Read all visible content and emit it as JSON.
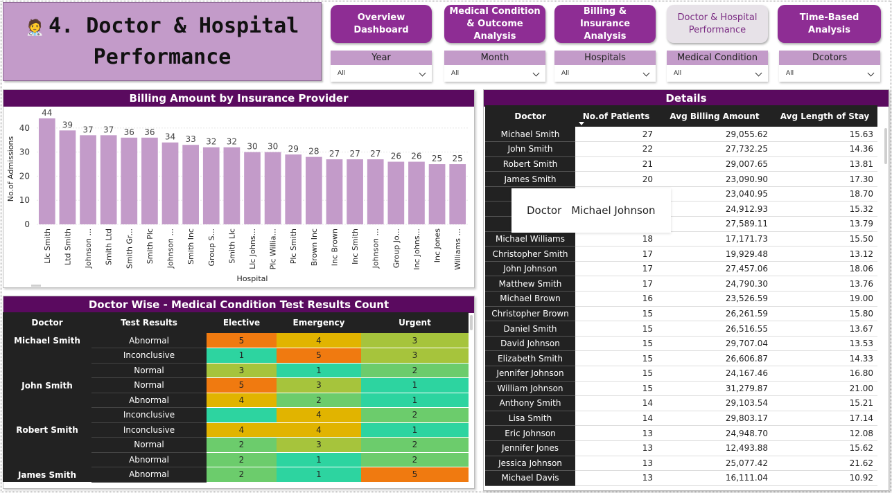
{
  "header": {
    "icon": "doctor-icon",
    "title_line1": "4. Doctor & Hospital",
    "title_line2": "Performance"
  },
  "nav": [
    {
      "label": "Overview Dashboard",
      "active": false
    },
    {
      "label": "Medical Condition & Outcome Analysis",
      "active": false
    },
    {
      "label": "Billing & Insurance Analysis",
      "active": false
    },
    {
      "label": "Doctor & Hospital Performance",
      "active": true
    },
    {
      "label": "Time-Based Analysis",
      "active": false
    }
  ],
  "slicers": [
    {
      "label": "Year",
      "value": "All"
    },
    {
      "label": "Month",
      "value": "All"
    },
    {
      "label": "Hospitals",
      "value": "All"
    },
    {
      "label": "Medical Condition",
      "value": "All"
    },
    {
      "label": "Dcotors",
      "value": "All"
    }
  ],
  "colors": {
    "brand": "#5a0a5f",
    "nav": "#8e2d94",
    "bar": "#c39bc9",
    "heat_high": "#f07a10",
    "heat_midhigh": "#e1b400",
    "heat_mid": "#a6c43c",
    "heat_midlow": "#6ccc6c",
    "heat_low": "#2dd4a0"
  },
  "chart_title": "Billing Amount by Insurance Provider",
  "chart_data": {
    "type": "bar",
    "title": "Billing Amount by Insurance Provider",
    "xlabel": "Hospital",
    "ylabel": "No.of Admissions",
    "ylim": [
      0,
      46
    ],
    "yticks": [
      0,
      10,
      20,
      30,
      40
    ],
    "grid": true,
    "categories": [
      "Llc Smith",
      "Ltd Smith",
      "Johnson ...",
      "Smith Ltd",
      "Smith Gr...",
      "Smith Plc",
      "Johnson ...",
      "Smith Inc",
      "Group S...",
      "Smith Llc",
      "Llc Johns...",
      "Plc Willia...",
      "Plc Smith",
      "Brown Inc",
      "Inc Brown",
      "Inc Smith",
      "Johnson ...",
      "Group Jo...",
      "Inc Johns...",
      "Inc Jones",
      "Williams ..."
    ],
    "values": [
      44,
      39,
      37,
      37,
      36,
      36,
      34,
      33,
      32,
      32,
      30,
      30,
      29,
      28,
      27,
      27,
      27,
      26,
      26,
      25,
      25
    ]
  },
  "matrix": {
    "title": "Doctor Wise - Medical Condition Test Results Count",
    "columns": [
      "Doctor",
      "Test Results",
      "Elective",
      "Emergency",
      "Urgent"
    ],
    "groups": [
      {
        "doctor": "Michael Smith",
        "rows": [
          {
            "result": "Abnormal",
            "elective": "5",
            "emergency": "4",
            "urgent": "3"
          },
          {
            "result": "Inconclusive",
            "elective": "1",
            "emergency": "5",
            "urgent": "3"
          },
          {
            "result": "Normal",
            "elective": "3",
            "emergency": "1",
            "urgent": "2"
          }
        ]
      },
      {
        "doctor": "John Smith",
        "rows": [
          {
            "result": "Normal",
            "elective": "5",
            "emergency": "3",
            "urgent": "1"
          },
          {
            "result": "Abnormal",
            "elective": "4",
            "emergency": "2",
            "urgent": "1"
          },
          {
            "result": "Inconclusive",
            "elective": "",
            "emergency": "4",
            "urgent": "2"
          }
        ]
      },
      {
        "doctor": "Robert Smith",
        "rows": [
          {
            "result": "Inconclusive",
            "elective": "4",
            "emergency": "4",
            "urgent": "1"
          },
          {
            "result": "Normal",
            "elective": "2",
            "emergency": "3",
            "urgent": "2"
          },
          {
            "result": "Abnormal",
            "elective": "2",
            "emergency": "1",
            "urgent": "2"
          }
        ]
      },
      {
        "doctor": "James Smith",
        "rows": [
          {
            "result": "Abnormal",
            "elective": "2",
            "emergency": "1",
            "urgent": "5"
          }
        ]
      }
    ]
  },
  "details": {
    "title": "Details",
    "columns": [
      "Doctor",
      "No.of Patients",
      "Avg Billing Amount",
      "Avg Length of Stay"
    ],
    "rows": [
      [
        "Michael Smith",
        "27",
        "29,055.62",
        "15.63"
      ],
      [
        "John Smith",
        "22",
        "27,732.25",
        "14.36"
      ],
      [
        "Robert Smith",
        "21",
        "29,007.65",
        "13.81"
      ],
      [
        "James Smith",
        "20",
        "23,090.90",
        "17.30"
      ],
      [
        "Mich",
        "",
        "23,040.95",
        "18.70"
      ],
      [
        "Da",
        "",
        "24,912.93",
        "15.32"
      ],
      [
        "Rob",
        "",
        "27,589.11",
        "13.79"
      ],
      [
        "Michael Williams",
        "18",
        "17,171.73",
        "15.50"
      ],
      [
        "Christopher Smith",
        "17",
        "19,929.48",
        "13.12"
      ],
      [
        "John Johnson",
        "17",
        "27,457.06",
        "18.06"
      ],
      [
        "Matthew Smith",
        "17",
        "24,790.30",
        "13.76"
      ],
      [
        "Michael Brown",
        "16",
        "23,526.59",
        "19.00"
      ],
      [
        "Christopher Brown",
        "15",
        "26,261.59",
        "15.80"
      ],
      [
        "Daniel Smith",
        "15",
        "26,516.55",
        "13.67"
      ],
      [
        "David Johnson",
        "15",
        "29,707.04",
        "13.53"
      ],
      [
        "Elizabeth Smith",
        "15",
        "26,606.87",
        "14.33"
      ],
      [
        "Jennifer Johnson",
        "15",
        "24,167.46",
        "16.80"
      ],
      [
        "William Johnson",
        "15",
        "31,279.87",
        "21.00"
      ],
      [
        "Anthony Smith",
        "14",
        "29,103.54",
        "15.21"
      ],
      [
        "Lisa Smith",
        "14",
        "29,803.17",
        "17.14"
      ],
      [
        "Eric Johnson",
        "13",
        "24,948.70",
        "12.08"
      ],
      [
        "Jennifer Jones",
        "13",
        "12,493.88",
        "15.62"
      ],
      [
        "Jessica Johnson",
        "13",
        "25,077.42",
        "21.62"
      ],
      [
        "Michael Davis",
        "13",
        "16,111.04",
        "10.92"
      ]
    ]
  },
  "tooltip": {
    "key": "Doctor",
    "value": "Michael Johnson"
  }
}
